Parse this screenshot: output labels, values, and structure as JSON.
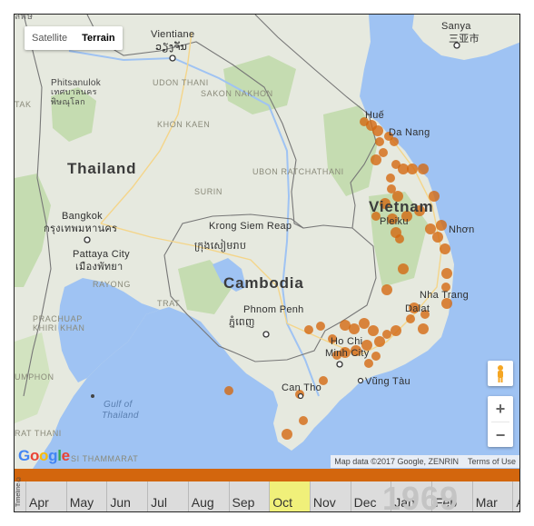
{
  "map_type": {
    "satellite_label": "Satellite",
    "terrain_label": "Terrain",
    "selected": "Terrain"
  },
  "places": {
    "vientiane": "Vientiane",
    "vientiane_local": "ວຽງຈັນ",
    "udon_thani": "UDON THANI",
    "sakon_nakhon": "SAKON NAKHON",
    "phitsanulok": "Phitsanulok",
    "phitsanulok_local": "เทศบาลนคร พิษณุโลก",
    "khon_kaen": "KHON KAEN",
    "thailand": "Thailand",
    "ubon_ratchathani": "UBON RATCHATHANI",
    "surin": "SURIN",
    "bangkok": "Bangkok",
    "bangkok_local": "กรุงเทพมหานคร",
    "krong_siem_reap": "Krong Siem Reap",
    "siem_reap_local": "ក្រុងសៀមរាប",
    "pattaya": "Pattaya City",
    "pattaya_local": "เมืองพัทยา",
    "rayong": "RAYONG",
    "cambodia": "Cambodia",
    "trat": "TRAT",
    "phnom_penh": "Phnom Penh",
    "phnom_penh_local": "ភ្នំពេញ",
    "prachuap": "PRACHUAP",
    "khiri_khan": "KHIRI KHAN",
    "hue": "Huế",
    "da_nang": "Da Nang",
    "vietnam": "Vietnam",
    "pleiku": "Pleiku",
    "quy_nhon": "Nhơn",
    "nha_trang": "Nha Trang",
    "dalat": "Dalat",
    "hcmc_1": "Ho Chi",
    "hcmc_2": "Minh City",
    "vung_tau": "Vũng Tàu",
    "can_tho": "Can Tho",
    "gulf_1": "Gulf of",
    "gulf_2": "Thailand",
    "sanya": "Sanya",
    "sanya_local": "三亚市",
    "umphon": "UMPHON",
    "surat_thani": "RAT THANI",
    "thammarat": "SI THAMMARAT",
    "top_left": "ลพิษ",
    "tak": "TAK"
  },
  "controls": {
    "zoom_in": "+",
    "zoom_out": "−",
    "pegman": "pegman-icon"
  },
  "attribution": {
    "map_data": "Map data ©2017 Google, ZENRIN",
    "terms": "Terms of Use"
  },
  "logo": {
    "g": "G",
    "o1": "o",
    "o2": "o",
    "g2": "g",
    "l": "l",
    "e": "e"
  },
  "timeline": {
    "label": "Timeline ©",
    "year": "1969",
    "months": [
      "Apr",
      "May",
      "Jun",
      "Jul",
      "Aug",
      "Sep",
      "Oct",
      "Nov",
      "Dec",
      "Jan",
      "Feb",
      "Mar",
      "Apr"
    ],
    "highlighted_month": "Oct"
  },
  "colors": {
    "sea": "#9fc3f3",
    "land": "#e6e9df",
    "marker": "#d3660d",
    "timeline_bar": "#d3660d",
    "highlight": "#f0f07a"
  }
}
